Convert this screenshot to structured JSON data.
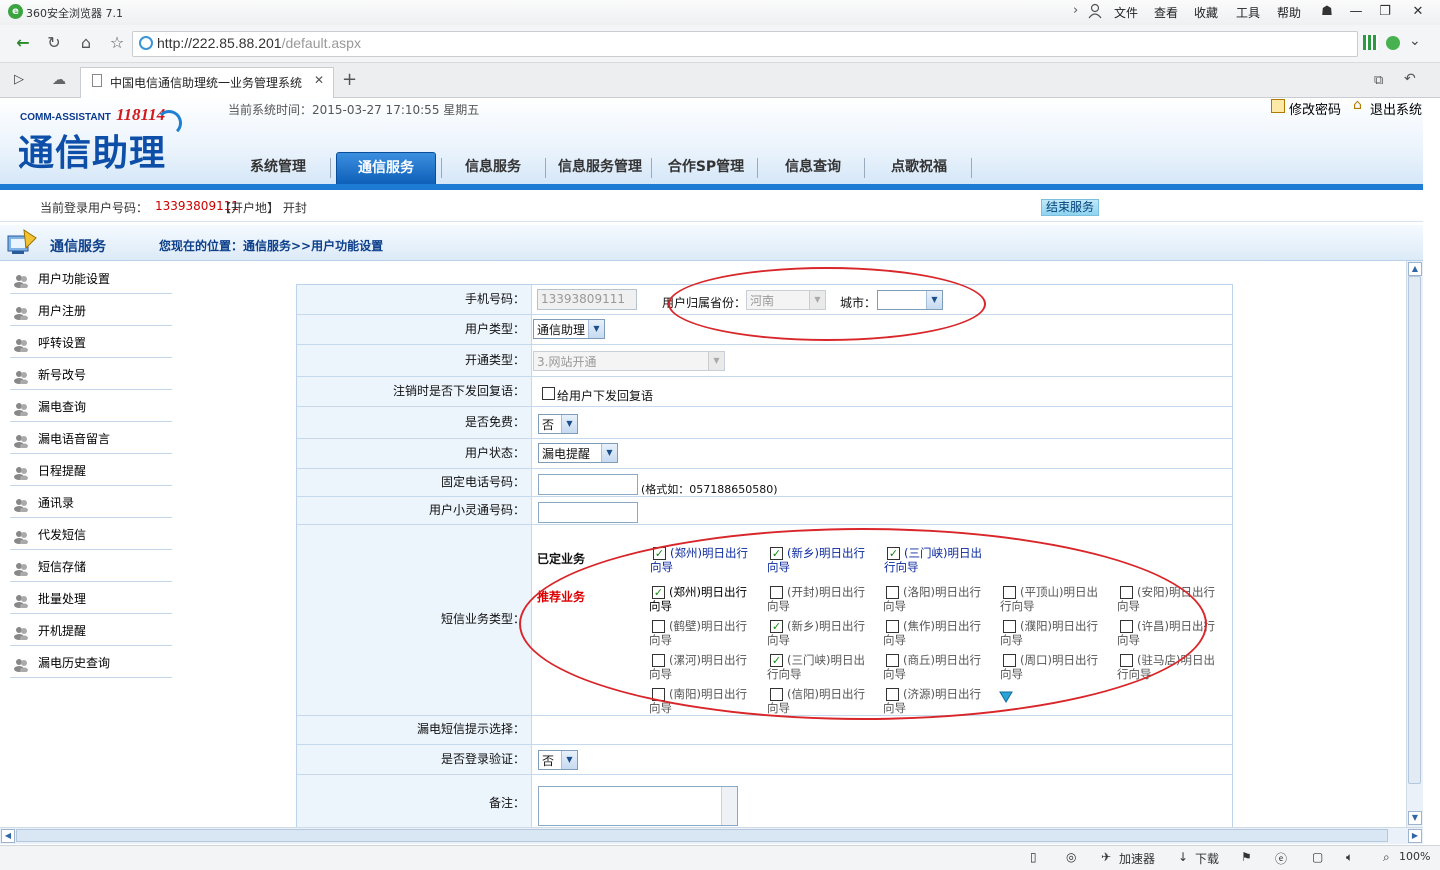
{
  "browser": {
    "app_title": "360安全浏览器 7.1",
    "menu": [
      "文件",
      "查看",
      "收藏",
      "工具",
      "帮助"
    ],
    "url_host": "http://222.85.88.201",
    "url_path": "/default.aspx",
    "tab_title": "中国电信通信助理统一业务管理系统",
    "new_tab": "+",
    "status": {
      "accelerator": "加速器",
      "download": "下载",
      "zoom": "100%"
    }
  },
  "header": {
    "logo_sub": "COMM-ASSISTANT",
    "logo_num": "118114",
    "logo_main": "通信助理",
    "systime": "当前系统时间：2015-03-27 17:10:55 星期五",
    "change_password": "修改密码",
    "logout": "退出系统",
    "nav": [
      "系统管理",
      "通信服务",
      "信息服务",
      "信息服务管理",
      "合作SP管理",
      "信息查询",
      "点歌祝福"
    ],
    "nav_active": "通信服务"
  },
  "userbar": {
    "label": "当前登录用户号码：",
    "number": "13393809111",
    "location": "【开户地】 开封",
    "end_service": "结束服务"
  },
  "section": {
    "title": "通信服务",
    "breadcrumb": "您现在的位置：通信服务>>用户功能设置"
  },
  "sidebar": {
    "items": [
      "用户功能设置",
      "用户注册",
      "呼转设置",
      "新号改号",
      "漏电查询",
      "漏电语音留言",
      "日程提醒",
      "通讯录",
      "代发短信",
      "短信存储",
      "批量处理",
      "开机提醒",
      "漏电历史查询"
    ]
  },
  "form": {
    "phone_label": "手机号码：",
    "phone_value": "13393809111",
    "province_label": "用户归属省份：",
    "province_value": "河南",
    "city_label": "城市：",
    "city_value": "",
    "user_type_label": "用户类型：",
    "user_type_value": "通信助理",
    "open_type_label": "开通类型：",
    "open_type_value": "3.网站开通",
    "cancel_reply_label": "注销时是否下发回复语：",
    "cancel_reply_option": "给用户下发回复语",
    "free_label": "是否免费：",
    "free_value": "否",
    "status_label": "用户状态：",
    "status_value": "漏电提醒",
    "fixed_label": "固定电话号码：",
    "fixed_hint": "(格式如：057188650580)",
    "phs_label": "用户小灵通号码：",
    "sms_label": "短信业务类型：",
    "subscribed_label": "已定业务",
    "recommended_label": "推荐业务",
    "subscribed": [
      {
        "text": "(郑州)明日出行向导",
        "checked": true
      },
      {
        "text": "(新乡)明日出行向导",
        "checked": true
      },
      {
        "text": "(三门峡)明日出行向导",
        "checked": true
      }
    ],
    "recommended": [
      {
        "text": "(郑州)明日出行向导",
        "checked": true
      },
      {
        "text": "(开封)明日出行向导",
        "checked": false
      },
      {
        "text": "(洛阳)明日出行向导",
        "checked": false
      },
      {
        "text": "(平顶山)明日出行向导",
        "checked": false
      },
      {
        "text": "(安阳)明日出行向导",
        "checked": false
      },
      {
        "text": "(鹤壁)明日出行向导",
        "checked": false
      },
      {
        "text": "(新乡)明日出行向导",
        "checked": true
      },
      {
        "text": "(焦作)明日出行向导",
        "checked": false
      },
      {
        "text": "(濮阳)明日出行向导",
        "checked": false
      },
      {
        "text": "(许昌)明日出行向导",
        "checked": false
      },
      {
        "text": "(漯河)明日出行向导",
        "checked": false
      },
      {
        "text": "(三门峡)明日出行向导",
        "checked": true
      },
      {
        "text": "(商丘)明日出行向导",
        "checked": false
      },
      {
        "text": "(周口)明日出行向导",
        "checked": false
      },
      {
        "text": "(驻马店)明日出行向导",
        "checked": false
      },
      {
        "text": "(南阳)明日出行向导",
        "checked": false
      },
      {
        "text": "(信阳)明日出行向导",
        "checked": false
      },
      {
        "text": "(济源)明日出行向导",
        "checked": false
      }
    ],
    "missed_sms_label": "漏电短信提示选择：",
    "login_verify_label": "是否登录验证：",
    "login_verify_value": "否",
    "remark_label": "备注："
  }
}
